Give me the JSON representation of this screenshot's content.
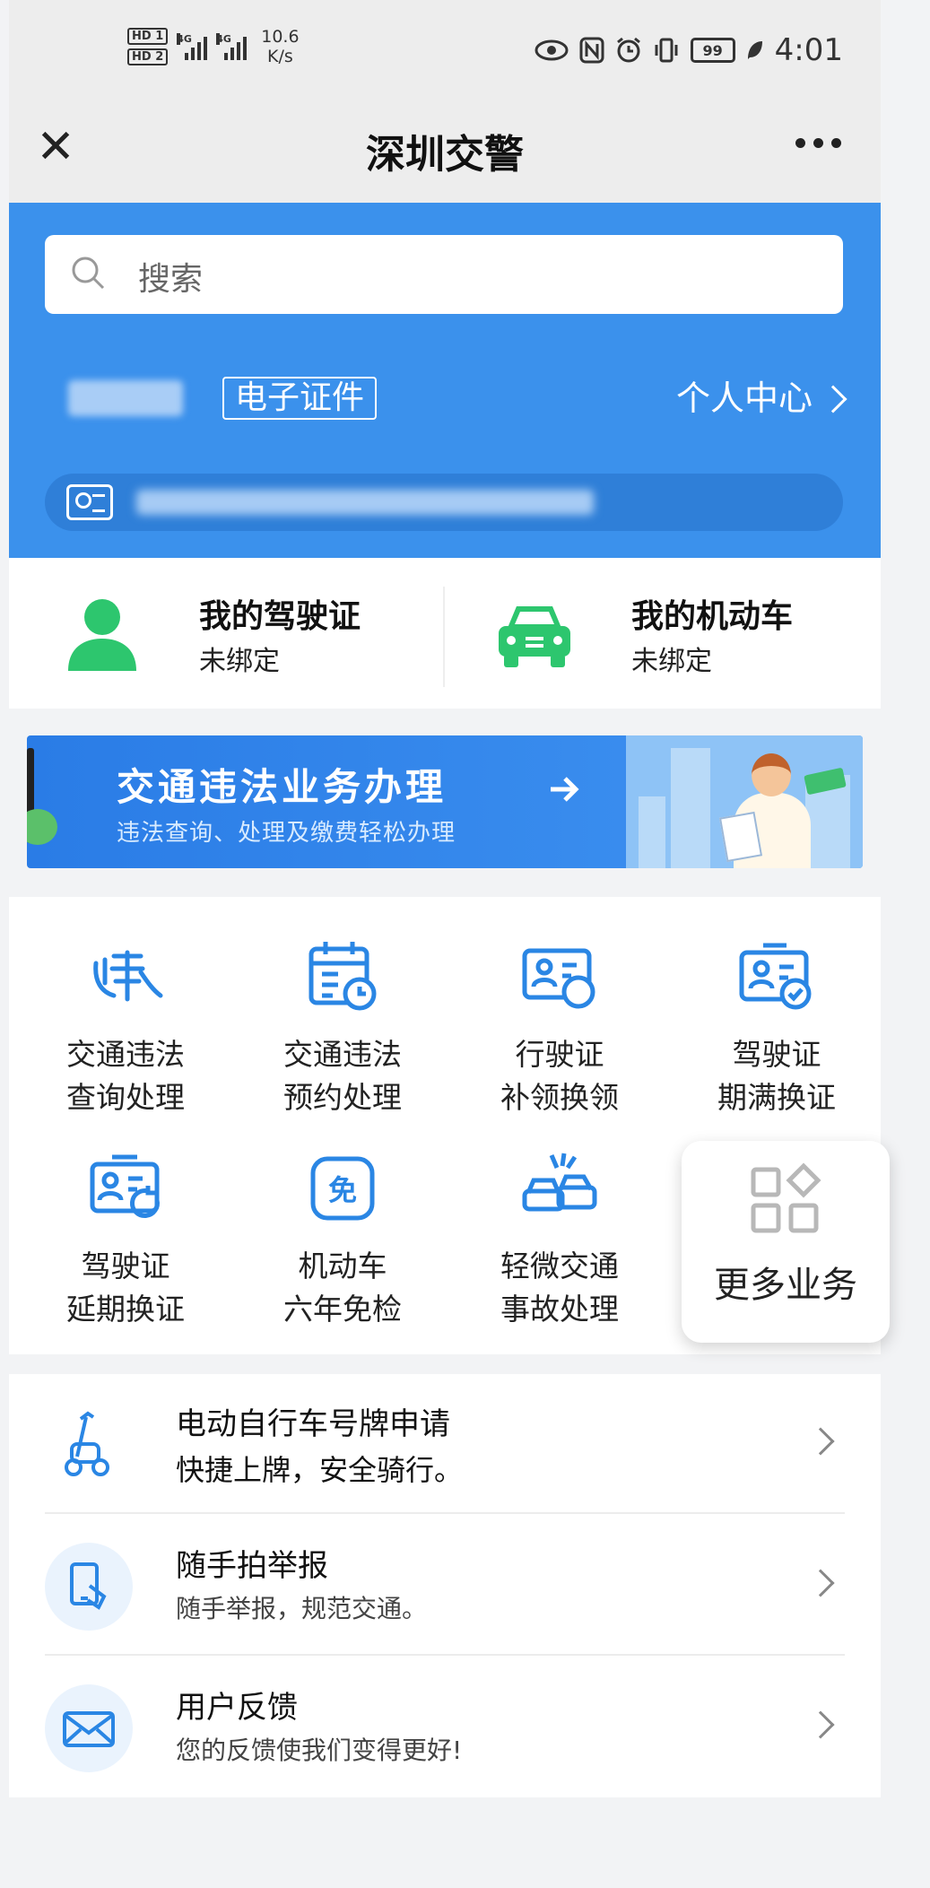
{
  "status_bar": {
    "hd1": "HD 1",
    "hd2": "HD 2",
    "net1": "4G",
    "net2": "4G",
    "speed_value": "10.6",
    "speed_unit": "K/s",
    "battery": "99",
    "time": "4:01"
  },
  "titlebar": {
    "close_icon": "close-icon",
    "title": "深圳交警",
    "more_icon": "more-icon"
  },
  "hero": {
    "search_placeholder": "搜索",
    "ecert_label": "电子证件",
    "personal_center": "个人中心"
  },
  "cards": [
    {
      "title": "我的驾驶证",
      "status": "未绑定",
      "icon": "person-icon",
      "color": "#2dc66e"
    },
    {
      "title": "我的机动车",
      "status": "未绑定",
      "icon": "car-icon",
      "color": "#2dc66e"
    }
  ],
  "banner": {
    "title": "交通违法业务办理",
    "subtitle": "违法查询、处理及缴费轻松办理"
  },
  "services": [
    {
      "line1": "交通违法",
      "line2": "查询处理",
      "icon": "violation-icon"
    },
    {
      "line1": "交通违法",
      "line2": "预约处理",
      "icon": "calendar-icon"
    },
    {
      "line1": "行驶证",
      "line2": "补领换领",
      "icon": "license-reissue-icon"
    },
    {
      "line1": "驾驶证",
      "line2": "期满换证",
      "icon": "license-check-icon"
    },
    {
      "line1": "驾驶证",
      "line2": "延期换证",
      "icon": "license-renew-icon"
    },
    {
      "line1": "机动车",
      "line2": "六年免检",
      "icon": "exempt-icon"
    },
    {
      "line1": "轻微交通",
      "line2": "事故处理",
      "icon": "accident-icon"
    }
  ],
  "more_services": {
    "label": "更多业务",
    "icon": "grid-icon"
  },
  "list": [
    {
      "title": "电动自行车号牌申请",
      "subtitle": "快捷上牌，安全骑行。",
      "icon": "scooter-icon"
    },
    {
      "title": "随手拍举报",
      "subtitle": "随手举报，规范交通。",
      "icon": "phone-report-icon"
    },
    {
      "title": "用户反馈",
      "subtitle": "您的反馈使我们变得更好!",
      "icon": "mail-icon"
    }
  ],
  "colors": {
    "brand_blue": "#3b91ec",
    "icon_blue": "#2a86e4",
    "green": "#2dc66e"
  }
}
